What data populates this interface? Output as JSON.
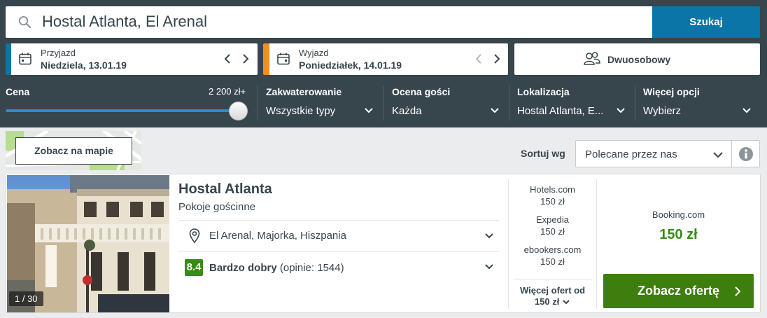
{
  "search": {
    "query": "Hostal Atlanta, El Arenal",
    "button_label": "Szukaj"
  },
  "checkin": {
    "label": "Przyjazd",
    "value": "Niedziela, 13.01.19"
  },
  "checkout": {
    "label": "Wyjazd",
    "value": "Poniedziałek, 14.01.19"
  },
  "guests": {
    "label": "Dwuosobowy"
  },
  "filters": {
    "price": {
      "label": "Cena",
      "value": "2 200 zł+",
      "slider_level": 1.0
    },
    "accommodation": {
      "label": "Zakwaterowanie",
      "value": "Wszystkie typy"
    },
    "rating": {
      "label": "Ocena gości",
      "value": "Każda"
    },
    "location": {
      "label": "Lokalizacja",
      "value": "Hostal Atlanta, E..."
    },
    "more": {
      "label": "Więcej opcji",
      "value": "Wybierz"
    }
  },
  "map": {
    "button_label": "Zobacz na mapie"
  },
  "sort": {
    "label": "Sortuj wg",
    "value": "Polecane przez nas"
  },
  "result": {
    "name": "Hostal Atlanta",
    "type": "Pokoje gościnne",
    "photo_counter": "1 / 30",
    "location": "El Arenal, Majorka, Hiszpania",
    "rating_score": "8.4",
    "rating_label": "Bardzo dobry",
    "rating_reviews": "(opinie: 1544)",
    "providers": [
      {
        "name": "Hotels.com",
        "price": "150 zł"
      },
      {
        "name": "Expedia",
        "price": "150 zł"
      },
      {
        "name": "ebookers.com",
        "price": "150 zł"
      }
    ],
    "more_offers_line1": "Więcej ofert od",
    "more_offers_line2": "150 zł",
    "best_provider": "Booking.com",
    "best_price": "150 zł",
    "deal_button": "Zobacz ofertę"
  },
  "colors": {
    "header_bg": "#37454d",
    "search_button": "#0a75a6",
    "checkout_accent": "#f28e1c",
    "deal_button": "#3d7e0e",
    "price_green": "#368c16"
  },
  "icons": [
    "search-icon",
    "calendar-icon",
    "chevron-left-icon",
    "chevron-right-icon",
    "guests-icon",
    "chevron-down-icon",
    "info-icon",
    "map-pin-icon"
  ]
}
